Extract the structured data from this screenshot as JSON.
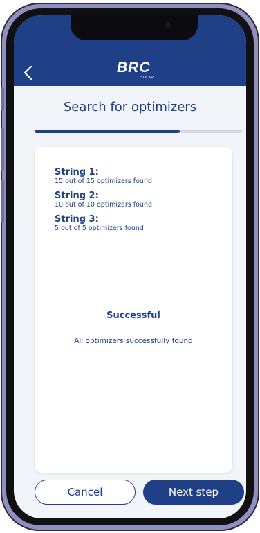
{
  "header": {
    "logo_text": "BRC",
    "logo_subtext": "SOLAR",
    "back_icon": "chevron-left-icon",
    "background_color": "#1f3f87"
  },
  "page": {
    "title": "Search for optimizers",
    "progress_percent": 70
  },
  "strings": [
    {
      "title": "String 1:",
      "detail": "15 out of 15 optimizers found"
    },
    {
      "title": "String 2:",
      "detail": "10 out of 10 optimizers found"
    },
    {
      "title": "String 3:",
      "detail": "5 out of 5 optimizers found"
    }
  ],
  "status": {
    "title": "Successful",
    "message": "All optimizers successfully found"
  },
  "buttons": {
    "cancel_label": "Cancel",
    "next_label": "Next step"
  },
  "colors": {
    "primary": "#1f3f87",
    "screen_background": "#f1f4f9",
    "card_background": "#ffffff",
    "track": "#d6d9e1"
  }
}
